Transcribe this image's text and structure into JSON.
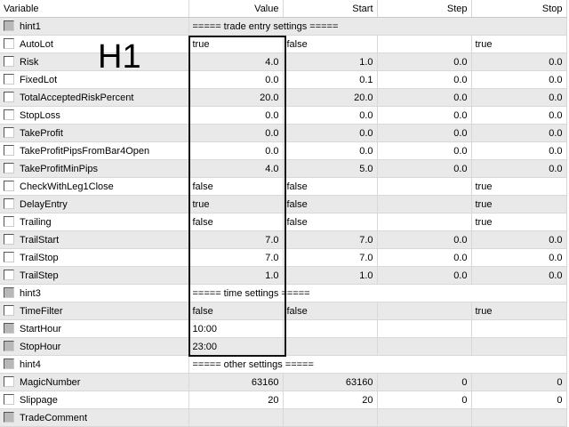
{
  "columns": [
    "Variable",
    "Value",
    "Start",
    "Step",
    "Stop"
  ],
  "annotation": "H1",
  "rows": [
    {
      "name": "hint1",
      "hint": "===== trade entry settings =====",
      "disabled": true
    },
    {
      "name": "AutoLot",
      "value": "true",
      "start": "false",
      "step": "",
      "stop": "true",
      "align": "l"
    },
    {
      "name": "Risk",
      "value": "4.0",
      "start": "1.0",
      "step": "0.0",
      "stop": "0.0"
    },
    {
      "name": "FixedLot",
      "value": "0.0",
      "start": "0.1",
      "step": "0.0",
      "stop": "0.0"
    },
    {
      "name": "TotalAcceptedRiskPercent",
      "value": "20.0",
      "start": "20.0",
      "step": "0.0",
      "stop": "0.0"
    },
    {
      "name": "StopLoss",
      "value": "0.0",
      "start": "0.0",
      "step": "0.0",
      "stop": "0.0"
    },
    {
      "name": "TakeProfit",
      "value": "0.0",
      "start": "0.0",
      "step": "0.0",
      "stop": "0.0"
    },
    {
      "name": "TakeProfitPipsFromBar4Open",
      "value": "0.0",
      "start": "0.0",
      "step": "0.0",
      "stop": "0.0"
    },
    {
      "name": "TakeProfitMinPips",
      "value": "4.0",
      "start": "5.0",
      "step": "0.0",
      "stop": "0.0"
    },
    {
      "name": "CheckWithLeg1Close",
      "value": "false",
      "start": "false",
      "step": "",
      "stop": "true",
      "align": "l"
    },
    {
      "name": "DelayEntry",
      "value": "true",
      "start": "false",
      "step": "",
      "stop": "true",
      "align": "l"
    },
    {
      "name": "Trailing",
      "value": "false",
      "start": "false",
      "step": "",
      "stop": "true",
      "align": "l"
    },
    {
      "name": "TrailStart",
      "value": "7.0",
      "start": "7.0",
      "step": "0.0",
      "stop": "0.0"
    },
    {
      "name": "TrailStop",
      "value": "7.0",
      "start": "7.0",
      "step": "0.0",
      "stop": "0.0"
    },
    {
      "name": "TrailStep",
      "value": "1.0",
      "start": "1.0",
      "step": "0.0",
      "stop": "0.0"
    },
    {
      "name": "hint3",
      "hint": "===== time settings =====",
      "disabled": true
    },
    {
      "name": "TimeFilter",
      "value": "false",
      "start": "false",
      "step": "",
      "stop": "true",
      "align": "l"
    },
    {
      "name": "StartHour",
      "value": "10:00",
      "start": "",
      "step": "",
      "stop": "",
      "align": "l",
      "disabled": true
    },
    {
      "name": "StopHour",
      "value": "23:00",
      "start": "",
      "step": "",
      "stop": "",
      "align": "l",
      "disabled": true
    },
    {
      "name": "hint4",
      "hint": "===== other settings =====",
      "disabled": true
    },
    {
      "name": "MagicNumber",
      "value": "63160",
      "start": "63160",
      "step": "0",
      "stop": "0"
    },
    {
      "name": "Slippage",
      "value": "20",
      "start": "20",
      "step": "0",
      "stop": "0"
    },
    {
      "name": "TradeComment",
      "value": "",
      "start": "",
      "step": "",
      "stop": "",
      "disabled": true
    }
  ]
}
